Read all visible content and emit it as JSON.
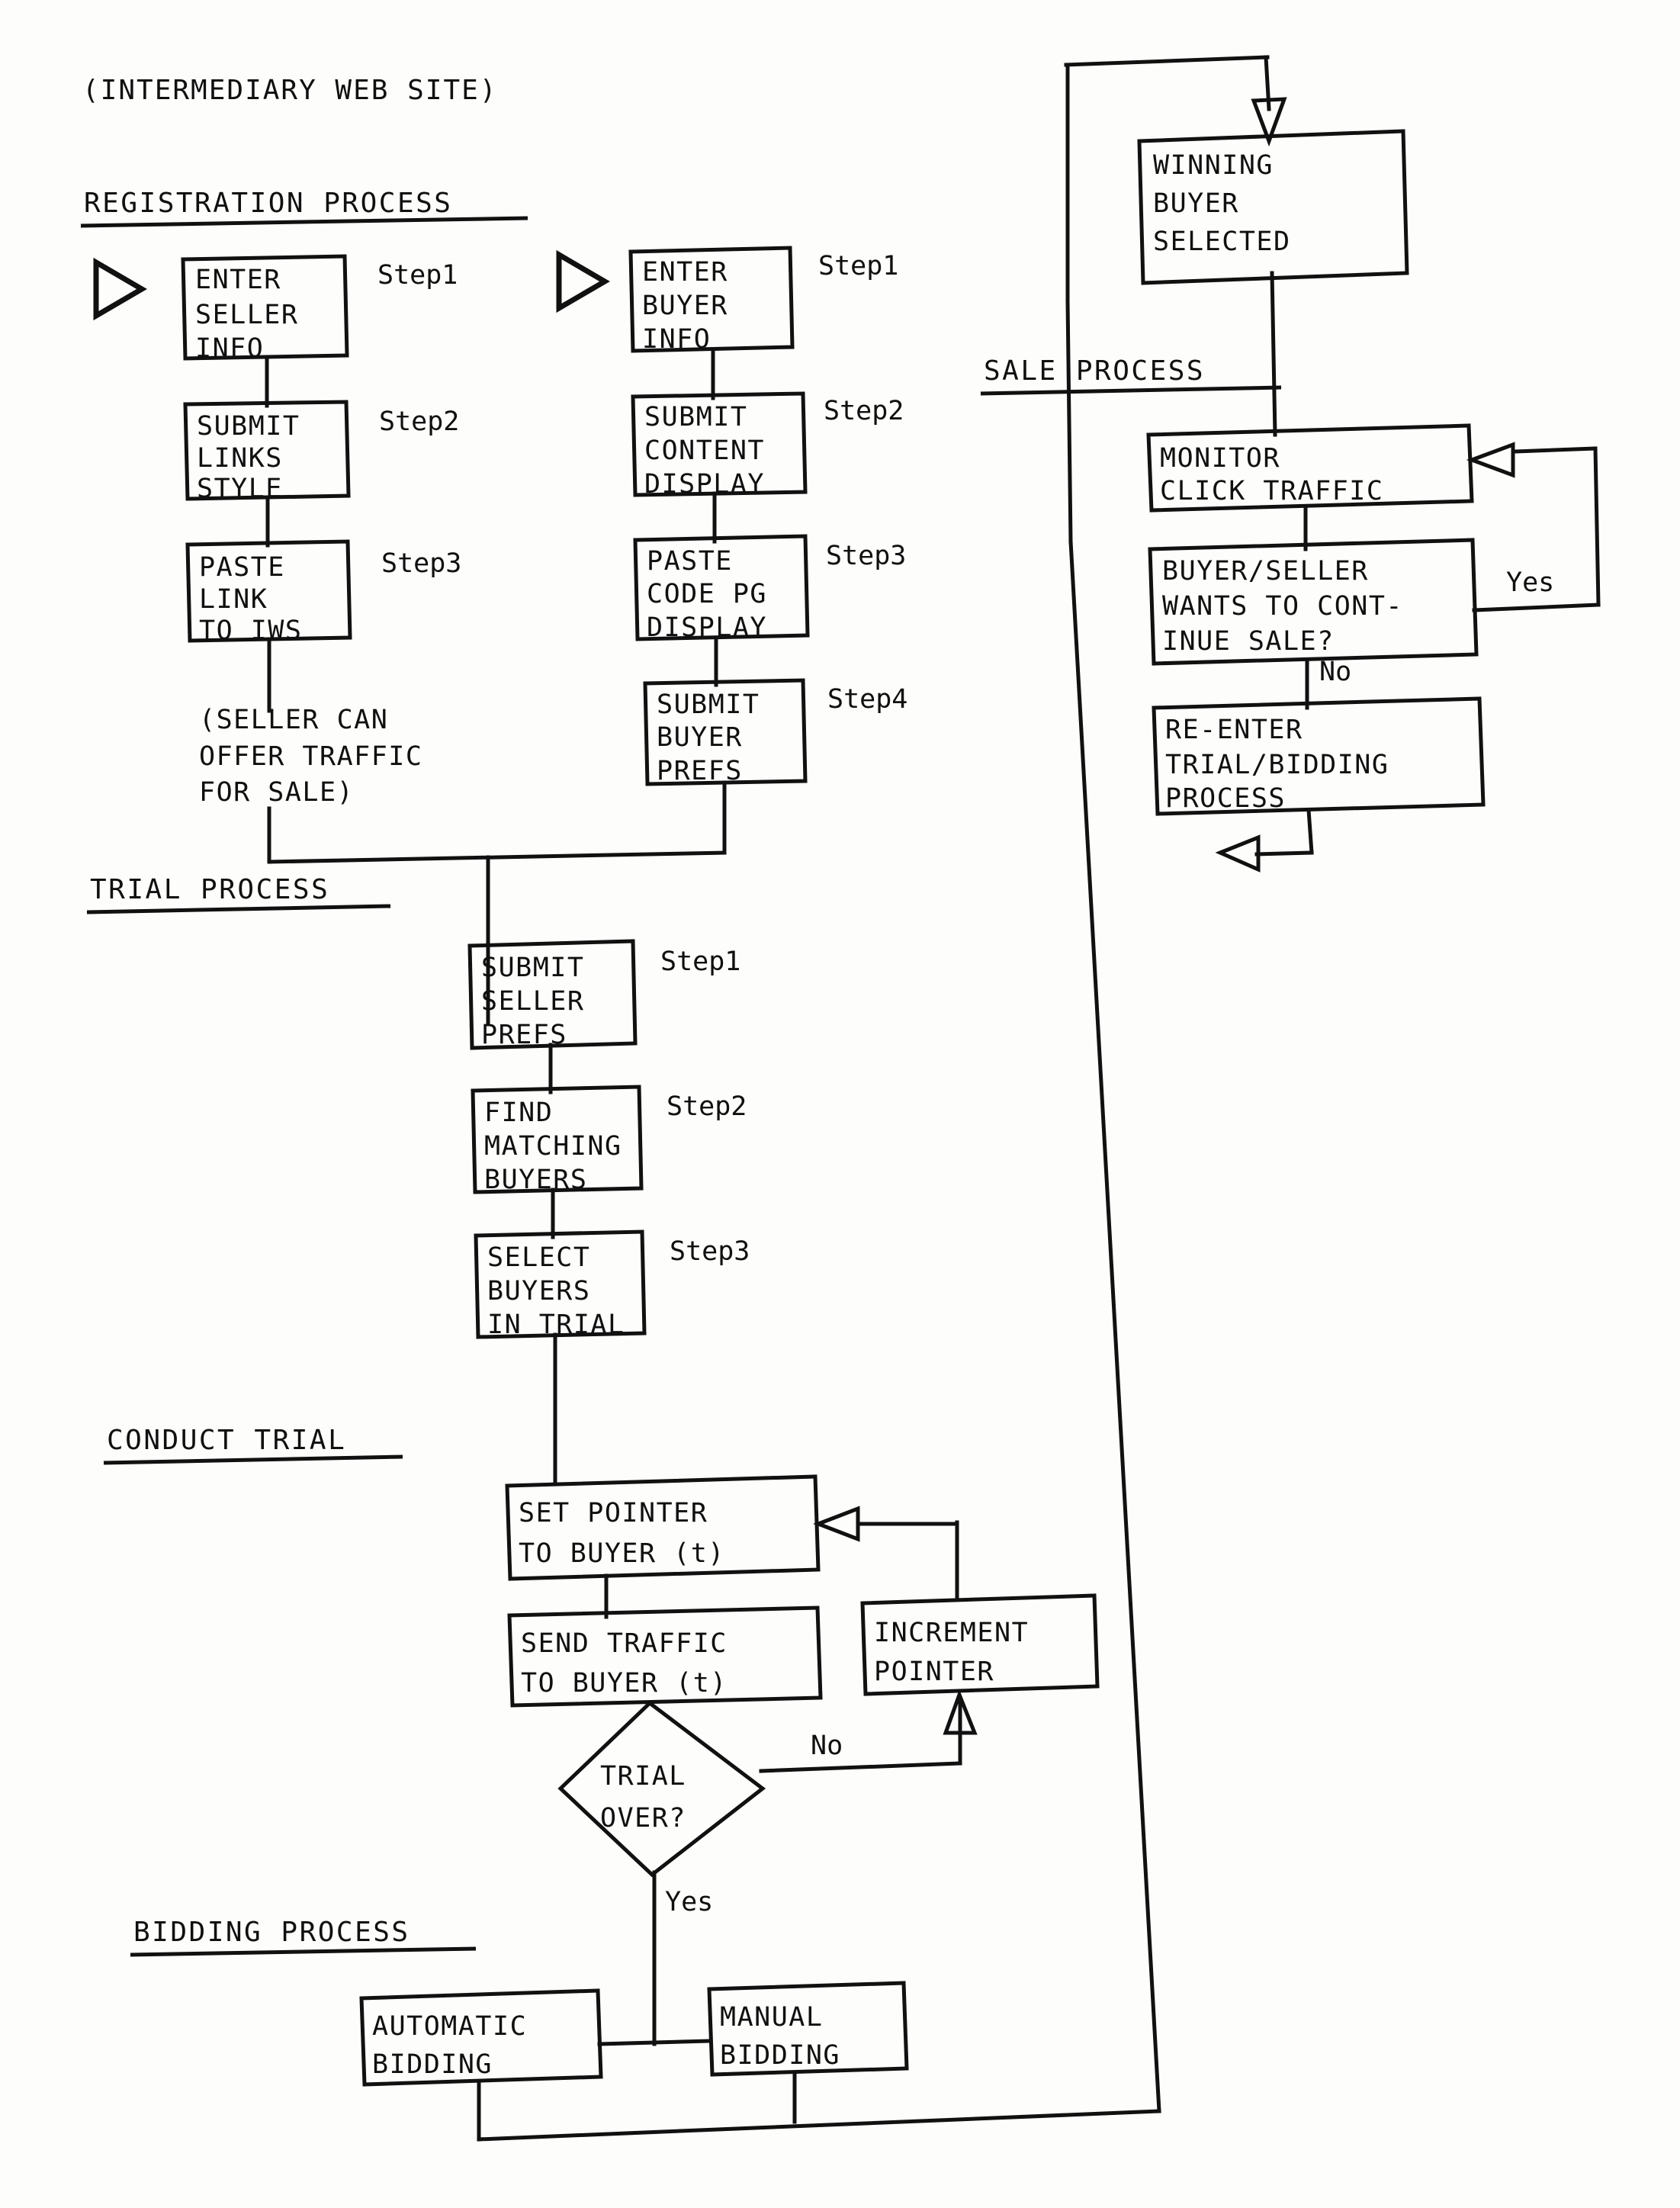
{
  "document": {
    "title": "(INTERMEDIARY WEB SITE)"
  },
  "sections": {
    "registration": "REGISTRATION PROCESS",
    "sale": "SALE PROCESS",
    "trial": "TRIAL PROCESS",
    "conduct_trial": "CONDUCT TRIAL",
    "bidding": "BIDDING PROCESS"
  },
  "seller_column": {
    "step1": {
      "label": "Step1",
      "lines": [
        "ENTER",
        "SELLER",
        "INFO"
      ]
    },
    "step2": {
      "label": "Step2",
      "lines": [
        "SUBMIT",
        "LINKS",
        "STYLE"
      ]
    },
    "step3": {
      "label": "Step3",
      "lines": [
        "PASTE",
        "LINK",
        "TO IWS"
      ]
    },
    "note": [
      "(SELLER CAN",
      "OFFER TRAFFIC",
      "FOR SALE)"
    ]
  },
  "buyer_column": {
    "step1": {
      "label": "Step1",
      "lines": [
        "ENTER",
        "BUYER",
        "INFO"
      ]
    },
    "step2": {
      "label": "Step2",
      "lines": [
        "SUBMIT",
        "CONTENT",
        "DISPLAY"
      ]
    },
    "step3": {
      "label": "Step3",
      "lines": [
        "PASTE",
        "CODE PG",
        "DISPLAY"
      ]
    },
    "step4": {
      "label": "Step4",
      "lines": [
        "SUBMIT",
        "BUYER",
        "PREFS"
      ]
    }
  },
  "trial_column": {
    "step1": {
      "label": "Step1",
      "lines": [
        "SUBMIT",
        "SELLER",
        "PREFS"
      ]
    },
    "step2": {
      "label": "Step2",
      "lines": [
        "FIND",
        "MATCHING",
        "BUYERS"
      ]
    },
    "step3": {
      "label": "Step3",
      "lines": [
        "SELECT",
        "BUYERS",
        "IN TRIAL"
      ]
    }
  },
  "conduct_trial_nodes": {
    "set_pointer": [
      "SET POINTER",
      "TO BUYER (t)"
    ],
    "send_traffic": [
      "SEND TRAFFIC",
      "TO BUYER (t)"
    ],
    "increment_pointer": [
      "INCREMENT",
      "POINTER"
    ],
    "decision": [
      "TRIAL",
      "OVER?"
    ],
    "decision_no": "No",
    "decision_yes": "Yes"
  },
  "bidding_nodes": {
    "automatic": [
      "AUTOMATIC",
      "BIDDING"
    ],
    "manual": [
      "MANUAL",
      "BIDDING"
    ]
  },
  "sale_nodes": {
    "winning_buyer": [
      "WINNING",
      "BUYER",
      "SELECTED"
    ],
    "monitor": [
      "MONITOR",
      "CLICK TRAFFIC"
    ],
    "continue_decision": [
      "BUYER/SELLER",
      "WANTS TO CONT-",
      "INUE SALE?"
    ],
    "continue_yes": "Yes",
    "continue_no": "No",
    "reenter": [
      "RE-ENTER",
      "TRIAL/BIDDING",
      "PROCESS"
    ]
  },
  "colors": {
    "ink": "#111111",
    "paper": "#fdfdfb"
  }
}
